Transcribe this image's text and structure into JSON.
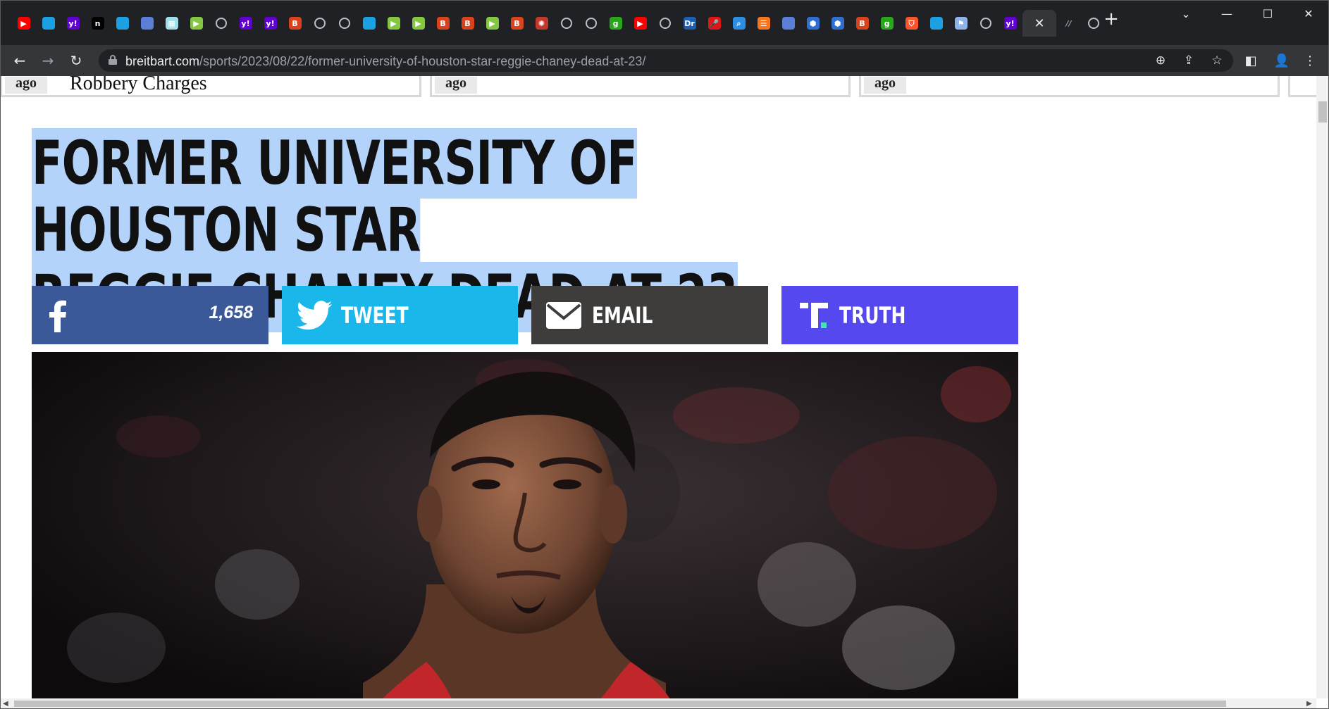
{
  "browser": {
    "tabs": [
      {
        "icon": "youtube-icon",
        "glyph": "▶",
        "color": "#ff0000"
      },
      {
        "icon": "shield-favicon-icon",
        "glyph": "",
        "color": "#1ba1e2"
      },
      {
        "icon": "yahoo-icon",
        "glyph": "y!",
        "color": "#6001d2"
      },
      {
        "icon": "n-favicon-icon",
        "glyph": "n",
        "color": "#000000"
      },
      {
        "icon": "shield-favicon-icon",
        "glyph": "",
        "color": "#1ba1e2"
      },
      {
        "icon": "flag-favicon-icon",
        "glyph": "",
        "color": "#5b7fd6"
      },
      {
        "icon": "grid-favicon-icon",
        "glyph": "▦",
        "color": "#9fdfe8"
      },
      {
        "icon": "rumble-icon",
        "glyph": "▶",
        "color": "#85c742"
      },
      {
        "icon": "globe-icon",
        "glyph": "",
        "color": "ring"
      },
      {
        "icon": "yahoo-icon",
        "glyph": "y!",
        "color": "#6001d2"
      },
      {
        "icon": "yahoo-icon",
        "glyph": "y!",
        "color": "#6001d2"
      },
      {
        "icon": "breitbart-icon",
        "glyph": "B",
        "color": "#d8421c"
      },
      {
        "icon": "globe-icon",
        "glyph": "",
        "color": "ring"
      },
      {
        "icon": "globe-icon",
        "glyph": "",
        "color": "ring"
      },
      {
        "icon": "shield-favicon-icon",
        "glyph": "",
        "color": "#1ba1e2"
      },
      {
        "icon": "rumble-icon",
        "glyph": "▶",
        "color": "#85c742"
      },
      {
        "icon": "rumble-icon",
        "glyph": "▶",
        "color": "#85c742"
      },
      {
        "icon": "breitbart-icon",
        "glyph": "B",
        "color": "#d8421c"
      },
      {
        "icon": "breitbart-icon",
        "glyph": "B",
        "color": "#d8421c"
      },
      {
        "icon": "rumble-icon",
        "glyph": "▶",
        "color": "#85c742"
      },
      {
        "icon": "breitbart-icon",
        "glyph": "B",
        "color": "#d8421c"
      },
      {
        "icon": "sunburst-favicon-icon",
        "glyph": "✺",
        "color": "#c0392b"
      },
      {
        "icon": "globe-icon",
        "glyph": "",
        "color": "ring"
      },
      {
        "icon": "globe-icon",
        "glyph": "",
        "color": "ring"
      },
      {
        "icon": "g-favicon-icon",
        "glyph": "g",
        "color": "#29a71a"
      },
      {
        "icon": "youtube-icon",
        "glyph": "▶",
        "color": "#ff0000"
      },
      {
        "icon": "globe-icon",
        "glyph": "",
        "color": "ring"
      },
      {
        "icon": "dr-favicon-icon",
        "glyph": "Dr",
        "color": "#1c5fb0"
      },
      {
        "icon": "mic-favicon-icon",
        "glyph": "🎤",
        "color": "#e01515"
      },
      {
        "icon": "search-favicon-icon",
        "glyph": "⌕",
        "color": "#2d8ee6"
      },
      {
        "icon": "bookmark-favicon-icon",
        "glyph": "☰",
        "color": "#f47621"
      },
      {
        "icon": "flag-favicon-icon",
        "glyph": "",
        "color": "#5b7fd6"
      },
      {
        "icon": "cube-favicon-icon",
        "glyph": "⬢",
        "color": "#2f6fd2"
      },
      {
        "icon": "cube-favicon-icon",
        "glyph": "⬢",
        "color": "#2f6fd2"
      },
      {
        "icon": "breitbart-icon",
        "glyph": "B",
        "color": "#d8421c"
      },
      {
        "icon": "g-favicon-icon",
        "glyph": "g",
        "color": "#29a71a"
      },
      {
        "icon": "brave-favicon-icon",
        "glyph": "⛉",
        "color": "#fb542b"
      },
      {
        "icon": "shield-favicon-icon",
        "glyph": "",
        "color": "#1ba1e2"
      },
      {
        "icon": "crest-favicon-icon",
        "glyph": "⚑",
        "color": "#8fb3e6"
      },
      {
        "icon": "globe-icon",
        "glyph": "",
        "color": "ring"
      },
      {
        "icon": "yahoo-icon",
        "glyph": "y!",
        "color": "#6001d2"
      }
    ],
    "active_tab_close": "✕",
    "trailing_tabs": [
      {
        "icon": "slash-favicon-icon",
        "glyph": "//",
        "color": "#9aa0a6"
      },
      {
        "icon": "globe-icon",
        "glyph": "",
        "color": "ring"
      }
    ],
    "new_tab_glyph": "+",
    "window_controls": {
      "tab_search": "⌄",
      "minimize": "—",
      "maximize": "☐",
      "close": "✕"
    },
    "nav": {
      "back": "←",
      "forward": "→",
      "reload": "↻"
    },
    "url_host": "breitbart.com",
    "url_path": "/sports/2023/08/22/former-university-of-houston-star-reggie-chaney-dead-at-23/",
    "omnibox_icons": {
      "zoom": "⊕",
      "share": "⇪",
      "bookmark": "☆"
    },
    "toolbar_icons": {
      "side_panel": "◧",
      "profile": "👤",
      "menu": "⋮"
    }
  },
  "ticker": [
    {
      "ago": "ago",
      "title": "Robbery Charges"
    },
    {
      "ago": "ago",
      "title": ""
    },
    {
      "ago": "ago",
      "title": ""
    }
  ],
  "article": {
    "headline_line1": "Former University of Houston Star",
    "headline_line2": "Reggie Chaney Dead at 23",
    "share": {
      "facebook_count": "1,658",
      "tweet_label": "Tweet",
      "email_label": "Email",
      "truth_label": "Truth"
    },
    "photo_alt": "Reggie Chaney"
  },
  "colors": {
    "facebook": "#3b5998",
    "twitter": "#1ab7ea",
    "email": "#3e3d3b",
    "truth": "#5448ee",
    "selection": "#b3d3fb"
  }
}
